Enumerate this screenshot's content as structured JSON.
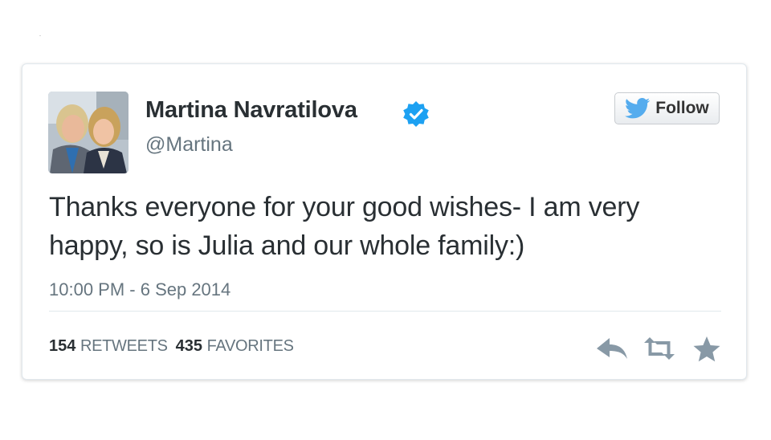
{
  "tweet": {
    "author": {
      "name": "Martina Navratilova",
      "handle": "@Martina",
      "verified": true
    },
    "follow_label": "Follow",
    "text": "Thanks everyone for your good wishes- I am very happy, so is Julia and our whole family:)",
    "timestamp": "10:00 PM - 6 Sep 2014",
    "stats": {
      "retweets_count": "154",
      "retweets_label": "RETWEETS",
      "favorites_count": "435",
      "favorites_label": "FAVORITES"
    },
    "actions": [
      "reply-icon",
      "retweet-icon",
      "favorite-icon"
    ]
  },
  "colors": {
    "twitter_blue": "#55acee",
    "verified_blue": "#1da1f2",
    "text_dark": "#292f33",
    "text_gray": "#66757f",
    "border": "#e1e8ed"
  }
}
